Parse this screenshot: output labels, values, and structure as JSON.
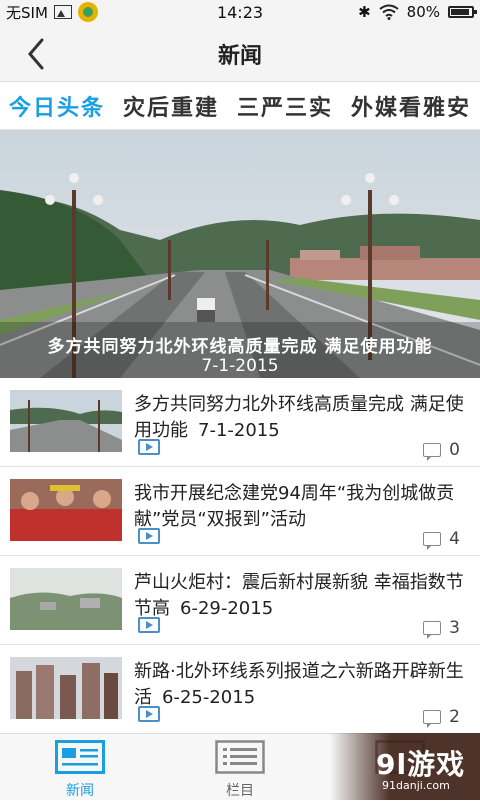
{
  "status": {
    "carrier": "无SIM",
    "time": "14:23",
    "battery": "80%"
  },
  "header": {
    "title": "新闻"
  },
  "tabs": [
    {
      "label": "今日头条",
      "active": true
    },
    {
      "label": "灾后重建",
      "active": false
    },
    {
      "label": "三严三实",
      "active": false
    },
    {
      "label": "外媒看雅安",
      "active": false
    }
  ],
  "hero": {
    "title": "多方共同努力北外环线高质量完成 满足使用功能",
    "date": "7-1-2015"
  },
  "news": [
    {
      "title": "多方共同努力北外环线高质量完成 满足使用功能",
      "date": "7-1-2015",
      "comments": "0"
    },
    {
      "title": "我市开展纪念建党94周年“我为创城做贡献”党员“双报到”活动",
      "date": "",
      "comments": "4"
    },
    {
      "title": "芦山火炬村：震后新村展新貌 幸福指数节节高",
      "date": "6-29-2015",
      "comments": "3"
    },
    {
      "title": "新路·北外环线系列报道之六新路开辟新生活",
      "date": "6-25-2015",
      "comments": "2"
    }
  ],
  "bottom_nav": [
    {
      "label": "新闻",
      "active": true
    },
    {
      "label": "栏目",
      "active": false
    },
    {
      "label": "",
      "active": false
    }
  ],
  "watermark": {
    "brand": "9l游戏",
    "site": "91danji.com"
  },
  "colors": {
    "accent": "#1aa0e0",
    "play_icon": "#4a8fc8"
  }
}
